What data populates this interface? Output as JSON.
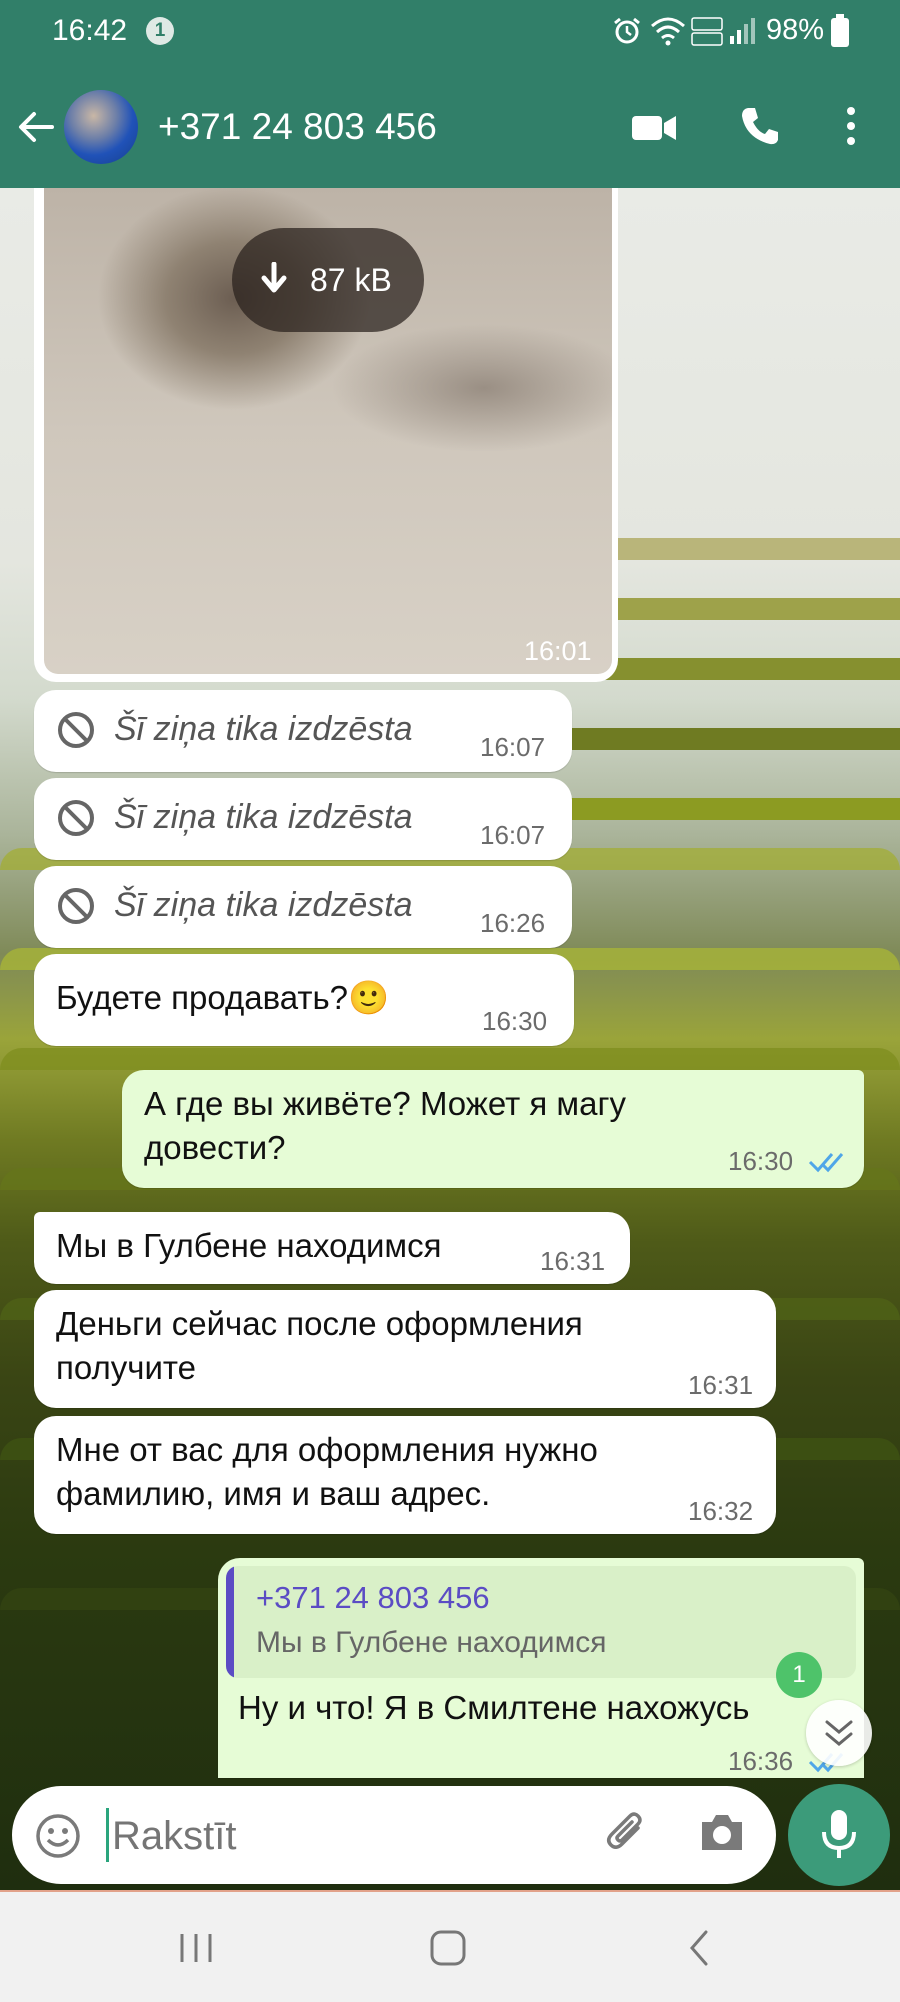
{
  "status_bar": {
    "time": "16:42",
    "notification_count": "1",
    "battery": "98%"
  },
  "header": {
    "contact": "+371 24 803 456"
  },
  "media_message": {
    "size": "87 kB",
    "time": "16:01"
  },
  "messages": [
    {
      "text": "Šī ziņa tika izdzēsta",
      "time": "16:07",
      "deleted": true
    },
    {
      "text": "Šī ziņa tika izdzēsta",
      "time": "16:07",
      "deleted": true
    },
    {
      "text": "Šī ziņa tika izdzēsta",
      "time": "16:26",
      "deleted": true
    },
    {
      "text": "Будете продавать?🙂",
      "time": "16:30"
    },
    {
      "text": "А где вы живëте? Может я  магу довести?",
      "time": "16:30",
      "outgoing": true
    },
    {
      "text": "Мы в Гулбене находимся",
      "time": "16:31"
    },
    {
      "text": "Деньги сейчас после оформления получите",
      "time": "16:31"
    },
    {
      "text": "Мне от вас для оформления нужно фамилию, имя и ваш адрес.",
      "time": "16:32"
    }
  ],
  "reply_message": {
    "quoted_author": "+371 24 803 456",
    "quoted_text": "Мы в Гулбене находимся",
    "text": "Ну и что! Я в Смилтене нахожусь",
    "time": "16:36"
  },
  "unread_badge": "1",
  "composer": {
    "placeholder": "Rakstīt"
  },
  "colors": {
    "header": "#317f69",
    "outgoing_bubble": "#e6fcd6",
    "mic_button": "#3c9b7a",
    "read_ticks": "#4fa6e8",
    "quote_accent": "#5b4cc4"
  }
}
